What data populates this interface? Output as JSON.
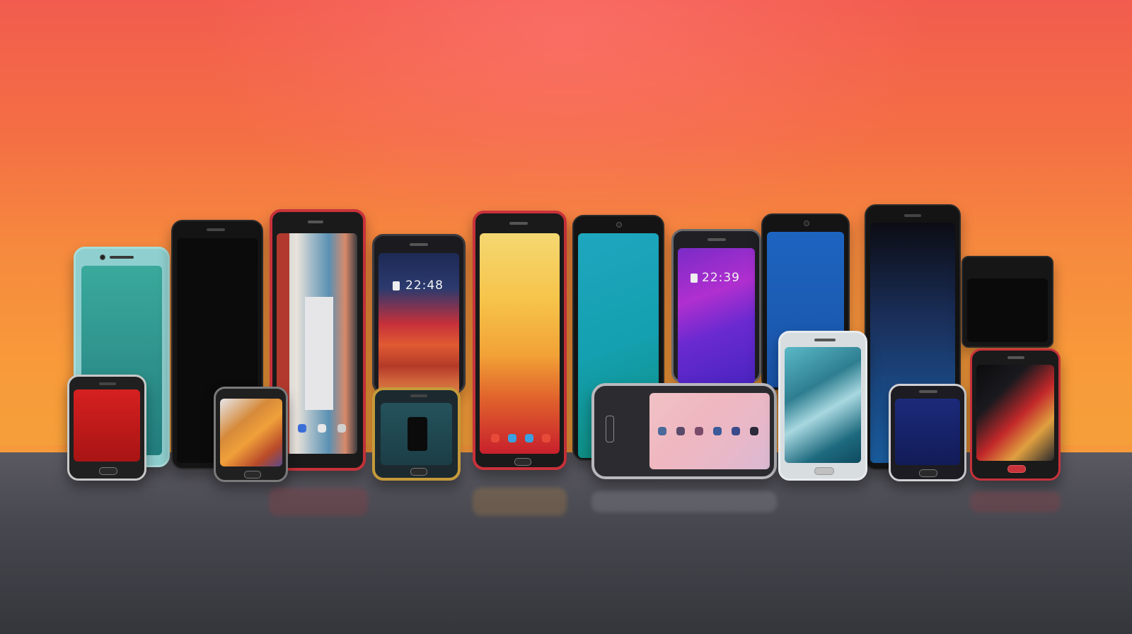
{
  "scene": {
    "subject": "row-of-smartphones",
    "phones": [
      {
        "id": "phone-teal",
        "screen_text": ""
      },
      {
        "id": "phone-black-tall",
        "screen_text": ""
      },
      {
        "id": "phone-red-architecture",
        "screen_text": ""
      },
      {
        "id": "phone-wave-lockscreen",
        "screen_text": "22:48"
      },
      {
        "id": "phone-yellow-red-wave",
        "screen_text": ""
      },
      {
        "id": "phone-cyan",
        "screen_text": ""
      },
      {
        "id": "phone-purple-lockscreen",
        "screen_text": "22:39"
      },
      {
        "id": "phone-blue",
        "screen_text": ""
      },
      {
        "id": "phone-navy-tall",
        "screen_text": ""
      },
      {
        "id": "phone-black-back",
        "screen_text": ""
      },
      {
        "id": "phone-small-red",
        "screen_text": ""
      },
      {
        "id": "phone-small-abstract",
        "screen_text": ""
      },
      {
        "id": "phone-small-gold",
        "screen_text": ""
      },
      {
        "id": "phone-landscape-pink",
        "screen_text": ""
      },
      {
        "id": "phone-silver-wave",
        "screen_text": ""
      },
      {
        "id": "phone-small-navy",
        "screen_text": ""
      },
      {
        "id": "phone-red-abstract",
        "screen_text": ""
      }
    ]
  },
  "colors": {
    "backdrop_top": "#f25c4e",
    "backdrop_bottom": "#f5a03a",
    "surface": "#47474f"
  }
}
